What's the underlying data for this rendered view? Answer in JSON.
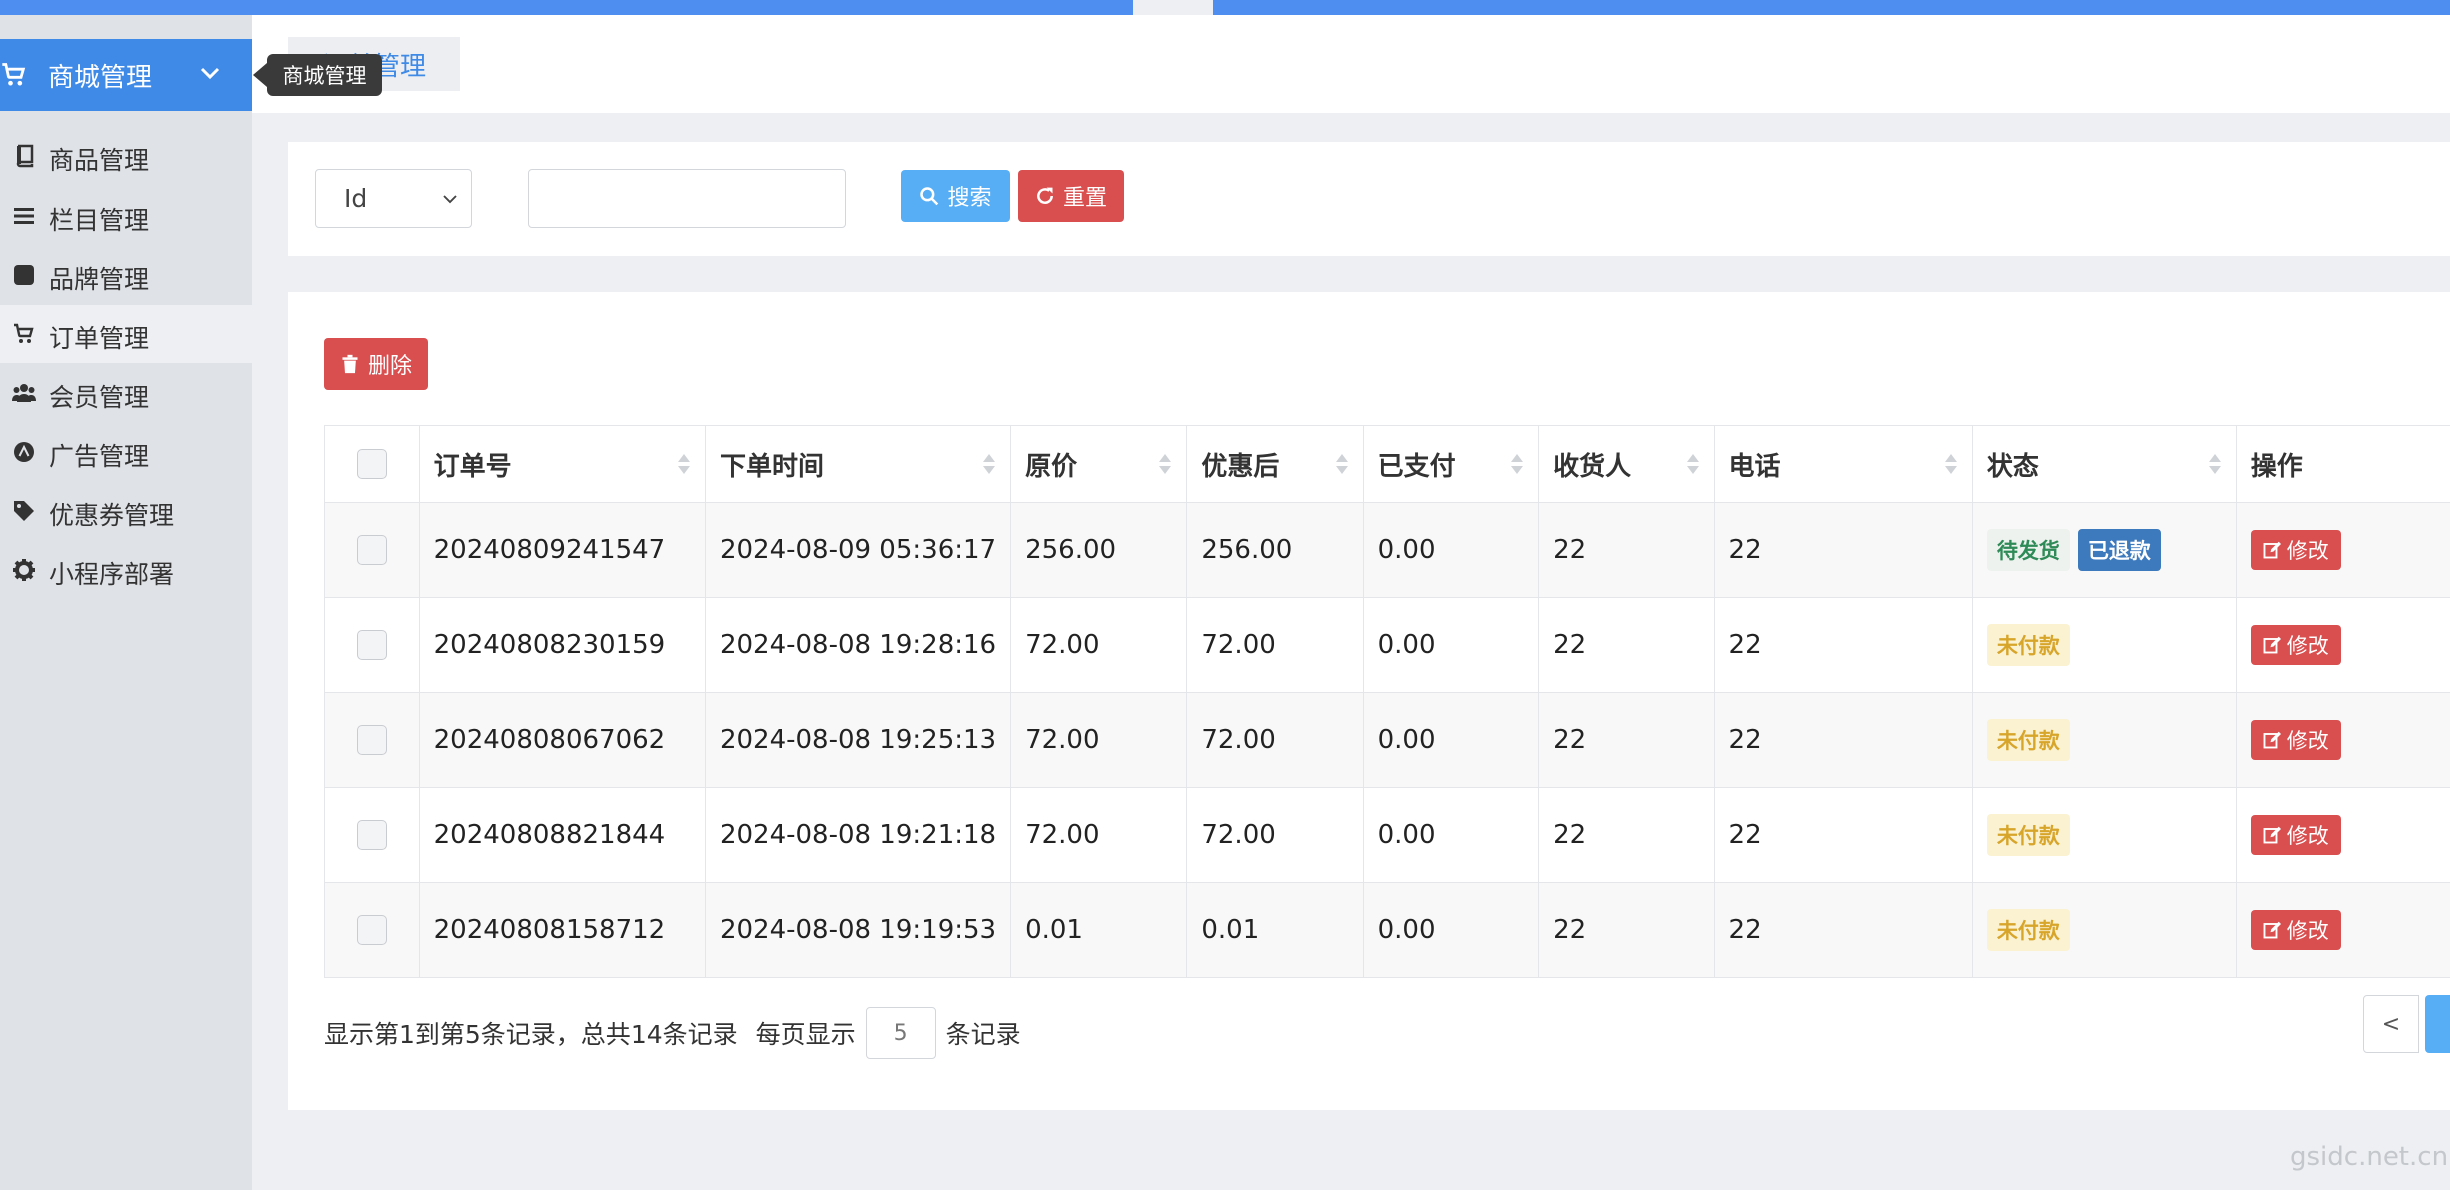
{
  "sidebar": {
    "header": {
      "label": "商城管理",
      "icon": "cart-icon"
    },
    "items": [
      {
        "label": "商品管理",
        "icon": "book-icon"
      },
      {
        "label": "栏目管理",
        "icon": "list-icon"
      },
      {
        "label": "品牌管理",
        "icon": "square-icon"
      },
      {
        "label": "订单管理",
        "icon": "cart-icon",
        "active": true
      },
      {
        "label": "会员管理",
        "icon": "users-icon"
      },
      {
        "label": "广告管理",
        "icon": "circle-a-icon"
      },
      {
        "label": "优惠券管理",
        "icon": "tag-icon"
      },
      {
        "label": "小程序部署",
        "icon": "gear-icon"
      }
    ]
  },
  "tooltip": {
    "text": "商城管理"
  },
  "breadcrumb": {
    "tab": "订单管理"
  },
  "search": {
    "field_select": "Id",
    "query": "",
    "search_label": "搜索",
    "reset_label": "重置"
  },
  "toolbar": {
    "delete_label": "删除"
  },
  "table": {
    "headers": [
      "订单号",
      "下单时间",
      "原价",
      "优惠后",
      "已支付",
      "收货人",
      "电话",
      "状态",
      "操作"
    ],
    "rows": [
      {
        "order_no": "20240809241547",
        "time": "2024-08-09 05:36:17",
        "price": "256.00",
        "discounted": "256.00",
        "paid": "0.00",
        "receiver": "22",
        "phone": "22",
        "status": [
          "待发货",
          "已退款"
        ],
        "action": "修改"
      },
      {
        "order_no": "20240808230159",
        "time": "2024-08-08 19:28:16",
        "price": "72.00",
        "discounted": "72.00",
        "paid": "0.00",
        "receiver": "22",
        "phone": "22",
        "status": [
          "未付款"
        ],
        "action": "修改"
      },
      {
        "order_no": "20240808067062",
        "time": "2024-08-08 19:25:13",
        "price": "72.00",
        "discounted": "72.00",
        "paid": "0.00",
        "receiver": "22",
        "phone": "22",
        "status": [
          "未付款"
        ],
        "action": "修改"
      },
      {
        "order_no": "20240808821844",
        "time": "2024-08-08 19:21:18",
        "price": "72.00",
        "discounted": "72.00",
        "paid": "0.00",
        "receiver": "22",
        "phone": "22",
        "status": [
          "未付款"
        ],
        "action": "修改"
      },
      {
        "order_no": "20240808158712",
        "time": "2024-08-08 19:19:53",
        "price": "0.01",
        "discounted": "0.01",
        "paid": "0.00",
        "receiver": "22",
        "phone": "22",
        "status": [
          "未付款"
        ],
        "action": "修改"
      }
    ]
  },
  "pagination": {
    "summary": "显示第1到第5条记录，总共14条记录",
    "per_page_prefix": "每页显示",
    "page_size": "5",
    "per_page_suffix": "条记录",
    "prev": "<"
  },
  "watermark": "gsidc.net.cn",
  "colors": {
    "primary": "#3f8ae6",
    "info": "#58aef5",
    "danger": "#d94f50",
    "warning_bg": "#fbf2d2",
    "warning_text": "#d8a52b"
  }
}
